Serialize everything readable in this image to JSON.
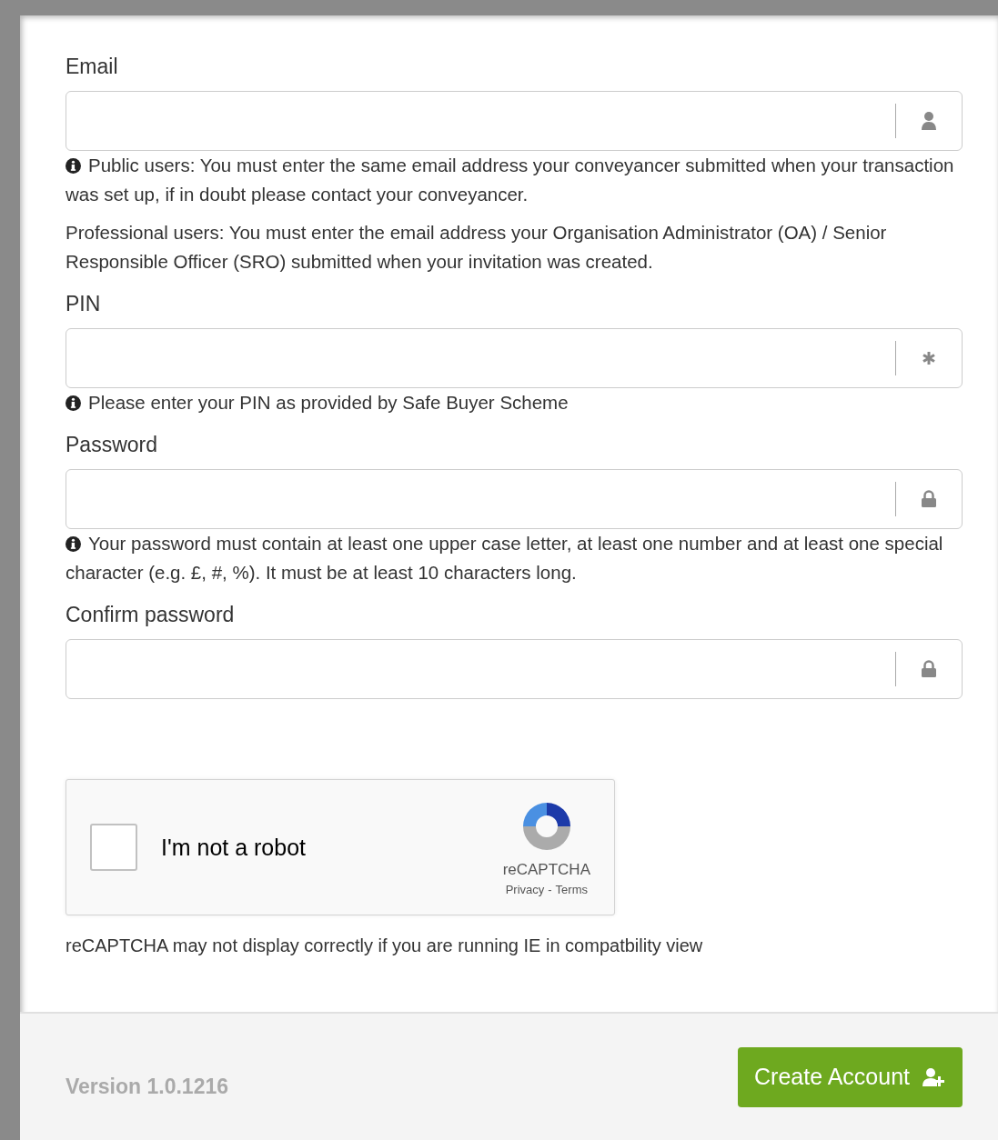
{
  "fields": [
    {
      "label": "Email",
      "kind": "user",
      "help": [
        {
          "kind": "info",
          "text": "Public users: You must enter the same email address your conveyancer submitted when your transaction was set up, if in doubt please contact your conveyancer."
        },
        {
          "kind": "plain",
          "text": "Professional users: You must enter the email address your Organisation Administrator (OA) / Senior Responsible Officer (SRO) submitted when your invitation was created."
        }
      ]
    },
    {
      "label": "PIN",
      "kind": "pin",
      "help": [
        {
          "kind": "info",
          "text": "Please enter your PIN as provided by Safe Buyer Scheme"
        }
      ]
    },
    {
      "label": "Password",
      "kind": "secret",
      "help": [
        {
          "kind": "info",
          "text": "Your password must contain at least one upper case letter, at least one number and at least one special character (e.g. £, #, %). It must be at least 10 characters long."
        }
      ]
    },
    {
      "label": "Confirm password",
      "kind": "secret"
    }
  ],
  "captcha": {
    "label": "I'm not a robot",
    "checked": false,
    "brand": "reCAPTCHA",
    "privacy": "Privacy",
    "separator": "-",
    "terms": "Terms"
  },
  "captcha_note": "reCAPTCHA may not display correctly if you are running IE in compatbility view",
  "footer": {
    "version": "Version 1.0.1216",
    "button": "Create Account"
  }
}
